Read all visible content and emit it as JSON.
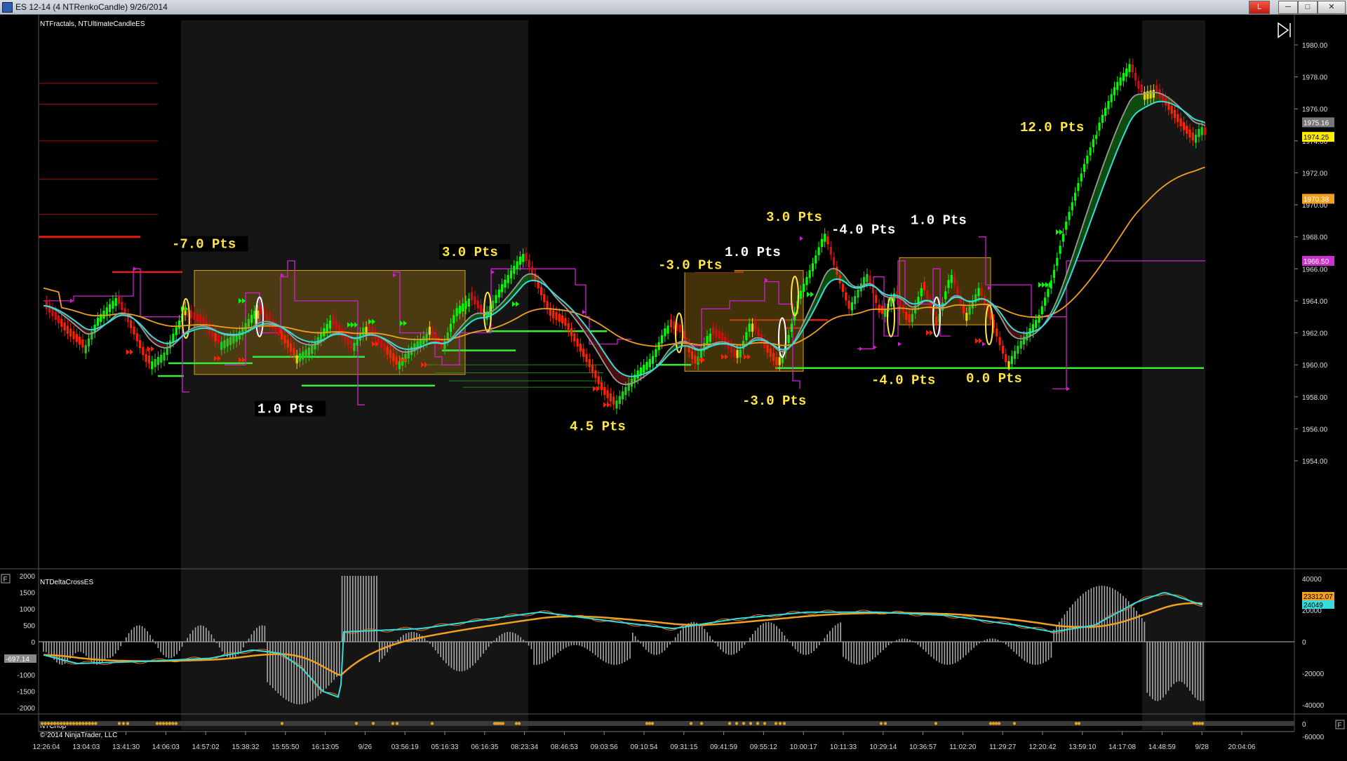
{
  "window": {
    "title": "ES 12-14 (4 NTRenkoCandle)  9/26/2014",
    "buttons": [
      "L",
      "─",
      "□",
      "✕"
    ]
  },
  "panels": {
    "main_indicators": "NTFractals, NTUltimateCandleES",
    "delta_indicator": "NTDeltaCrossES",
    "chop_indicator": "NTChop",
    "copyright": "© 2014 NinjaTrader, LLC",
    "f_button": "F",
    "f_button_right": "F"
  },
  "colors": {
    "background": "#000000",
    "session_shade": "#161616",
    "up_candle": "#22cc22",
    "strong_up_candle": "#00ff00",
    "down_candle": "#cc1111",
    "strong_down_candle": "#ff2200",
    "doji_candle": "#e8d300",
    "cyan_ma": "#33dddd",
    "gray_ma": "#9a9a9a",
    "orange_ma": "#f0a020",
    "magenta_stop": "#d020d0",
    "green_level": "#33ee33",
    "pts_label": "#ffe640",
    "box_fill": "#7a5a10",
    "box_border": "#d8a020"
  },
  "chart_data": {
    "type": "candlestick",
    "price_axis": {
      "min": 1954.0,
      "max": 1981.0,
      "ticks": [
        "1980.00",
        "1978.00",
        "1976.00",
        "1974.00",
        "1972.00",
        "1970.00",
        "1968.00",
        "1966.00",
        "1964.00",
        "1962.00",
        "1960.00",
        "1958.00",
        "1956.00",
        "1954.00"
      ],
      "markers": [
        {
          "label": "1975.16",
          "price": 1975.16,
          "color": "#777777"
        },
        {
          "label": "1974.25",
          "price": 1974.25,
          "color": "#ffee00"
        },
        {
          "label": "1970.38",
          "price": 1970.38,
          "color": "#f0a020"
        },
        {
          "label": "1966.50",
          "price": 1966.5,
          "color": "#cc33cc"
        }
      ]
    },
    "time_axis": [
      "12:26:04",
      "13:04:03",
      "13:41:30",
      "14:06:03",
      "14:57:02",
      "15:38:32",
      "15:55:50",
      "16:13:05",
      "9/26",
      "03:56:19",
      "05:16:33",
      "06:16:35",
      "08:23:34",
      "08:46:53",
      "09:03:56",
      "09:10:54",
      "09:31:15",
      "09:41:59",
      "09:55:12",
      "10:00:17",
      "10:11:33",
      "10:29:14",
      "10:36:57",
      "11:02:20",
      "11:29:27",
      "12:20:42",
      "13:59:10",
      "14:17:08",
      "14:48:59",
      "9/28",
      "20:04:06"
    ],
    "trade_labels": [
      {
        "text": "-7.0  Pts",
        "price": 1967.3,
        "color": "#ffe640"
      },
      {
        "text": "1.0  Pts",
        "price": 1957.0,
        "color": "#ffffff"
      },
      {
        "text": "3.0  Pts",
        "price": 1966.8,
        "color": "#ffe640"
      },
      {
        "text": "4.5  Pts",
        "price": 1955.9,
        "color": "#ffe640"
      },
      {
        "text": "-3.0  Pts",
        "price": 1966.0,
        "color": "#ffe640"
      },
      {
        "text": "1.0  Pts",
        "price": 1966.8,
        "color": "#ffffff"
      },
      {
        "text": "-3.0  Pts",
        "price": 1957.5,
        "color": "#ffe640"
      },
      {
        "text": "3.0  Pts",
        "price": 1969.0,
        "color": "#ffe640"
      },
      {
        "text": "-4.0  Pts",
        "price": 1968.2,
        "color": "#ffffff"
      },
      {
        "text": "1.0  Pts",
        "price": 1968.8,
        "color": "#ffffff"
      },
      {
        "text": "-4.0  Pts",
        "price": 1958.8,
        "color": "#ffe640"
      },
      {
        "text": "0.0  Pts",
        "price": 1958.9,
        "color": "#ffe640"
      },
      {
        "text": "12.0  Pts",
        "price": 1974.6,
        "color": "#ffe640"
      }
    ],
    "delta_axis_left": [
      "2000",
      "1500",
      "1000",
      "500",
      "0",
      "-500",
      "-1000",
      "-1500",
      "-2000"
    ],
    "delta_axis_right": [
      "40000",
      "20000",
      "0",
      "-20000",
      "-40000",
      "-60000"
    ],
    "delta_markers": [
      {
        "label": "23312.07",
        "color": "#f0a020"
      },
      {
        "label": "24049",
        "color": "#33dddd"
      },
      {
        "label": "-697.14",
        "color": "#888888"
      }
    ],
    "chop_axis": [
      "0"
    ]
  }
}
